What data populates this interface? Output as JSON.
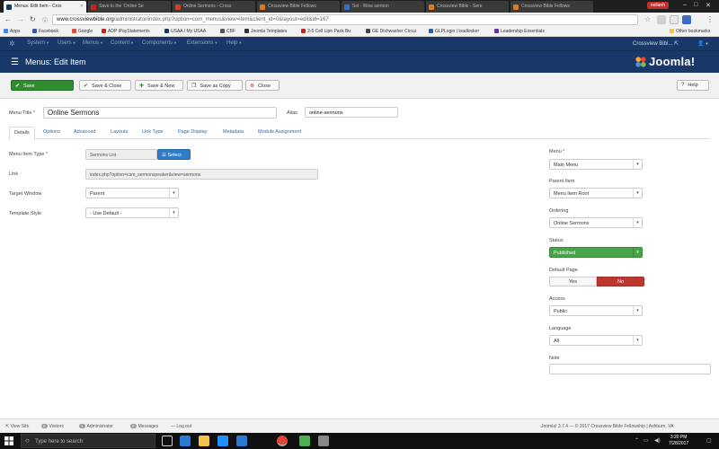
{
  "browser": {
    "tabs": [
      {
        "label": "Menus: Edit Item - Cros",
        "active": true,
        "favicon_color": "#1a3867"
      },
      {
        "label": "Save to the ‘Online Se",
        "active": false,
        "favicon_color": "#cc2222"
      },
      {
        "label": "Online Sermons - Cross",
        "active": false,
        "favicon_color": "#cc4422"
      },
      {
        "label": "Crossview Bible Fellows",
        "active": false,
        "favicon_color": "#e07a1f"
      },
      {
        "label": "Sol - Wow sermon",
        "active": false,
        "favicon_color": "#3b6cc6"
      },
      {
        "label": "Crossview Bible - Sere",
        "active": false,
        "favicon_color": "#e07a1f"
      },
      {
        "label": "Crossview Bible Fellows",
        "active": false,
        "favicon_color": "#e07a1f"
      }
    ],
    "user_badge": "neilanh",
    "back_glyph": "←",
    "forward_glyph": "→",
    "reload_glyph": "↻",
    "url_host": "www.crossviewbible.org",
    "url_path": "/administrator/index.php?option=com_menus&view=item&client_id=0&layout=edit&id=167",
    "bookmark_star": "☆",
    "bookmarks": [
      {
        "label": "Apps",
        "color": "#4285f4"
      },
      {
        "label": "Facebook",
        "color": "#3b5998"
      },
      {
        "label": "Google",
        "color": "#dd4b39"
      },
      {
        "label": "ADP iPayStatements",
        "color": "#cc2222"
      },
      {
        "label": "USAA / My USAA",
        "color": "#1a3867"
      },
      {
        "label": "CBF",
        "color": "#555555"
      },
      {
        "label": "Joomla Templates",
        "color": "#333333"
      },
      {
        "label": "2-5 Cell Lipo Pack Bu",
        "color": "#cc2222"
      },
      {
        "label": "GE Dishwasher Circui",
        "color": "#444444"
      },
      {
        "label": "GLPLogin | loadlocker",
        "color": "#2266aa"
      },
      {
        "label": "Leadership Essentials",
        "color": "#663399"
      }
    ],
    "other_bookmarks": "Other bookmarks"
  },
  "admin_nav": {
    "items": [
      "System",
      "Users",
      "Menus",
      "Content",
      "Components",
      "Extensions",
      "Help"
    ],
    "site_label": "Crossview Bibl..."
  },
  "header": {
    "title": "Menus: Edit Item",
    "brand": "Joomla!"
  },
  "toolbar": {
    "save": "Save",
    "save_close": "Save & Close",
    "save_new": "Save & New",
    "save_copy": "Save as Copy",
    "close": "Close",
    "help": "Help"
  },
  "form": {
    "menu_title_label": "Menu Title",
    "menu_title_value": "Online Sermons",
    "alias_label": "Alias",
    "alias_value": "online-sermons",
    "tabs": [
      "Details",
      "Options",
      "Advanced",
      "Layouts",
      "Link Type",
      "Page Display",
      "Metadata",
      "Module Assignment"
    ],
    "menu_item_type_label": "Menu Item Type",
    "menu_item_type_value": "Sermons List",
    "select_button": "Select",
    "link_label": "Link",
    "link_value": "index.php?option=com_sermonspeaker&view=sermons",
    "target_window_label": "Target Window",
    "target_window_value": "Parent",
    "template_style_label": "Template Style",
    "template_style_value": "- Use Default -"
  },
  "sidebar": {
    "menu_label": "Menu",
    "menu_value": "Main Menu",
    "parent_label": "Parent Item",
    "parent_value": "Menu Item Root",
    "ordering_label": "Ordering",
    "ordering_value": "Online Sermons",
    "status_label": "Status",
    "status_value": "Published",
    "default_page_label": "Default Page",
    "default_yes": "Yes",
    "default_no": "No",
    "access_label": "Access",
    "access_value": "Public",
    "language_label": "Language",
    "language_value": "All",
    "note_label": "Note",
    "note_value": ""
  },
  "status_bar": {
    "view_site": "View Site",
    "visitors_count": "0",
    "visitors": "Visitors",
    "admin_count": "1",
    "admin": "Administrator",
    "messages_count": "0",
    "messages": "Messages",
    "logout": "Log out",
    "footer": "Joomla! 3.7.4 — © 2017 Crossview Bible Fellowship | Ashburn, VA"
  },
  "taskbar": {
    "search_placeholder": "Type here to search",
    "time": "3:20 PM",
    "date": "7/28/2017",
    "app_colors": [
      "#cccccc",
      "#2b7bd6",
      "#f2c24b",
      "#1e90ff",
      "#2b7bd6",
      "#dd4433",
      "#4caf50",
      "#888888"
    ]
  }
}
